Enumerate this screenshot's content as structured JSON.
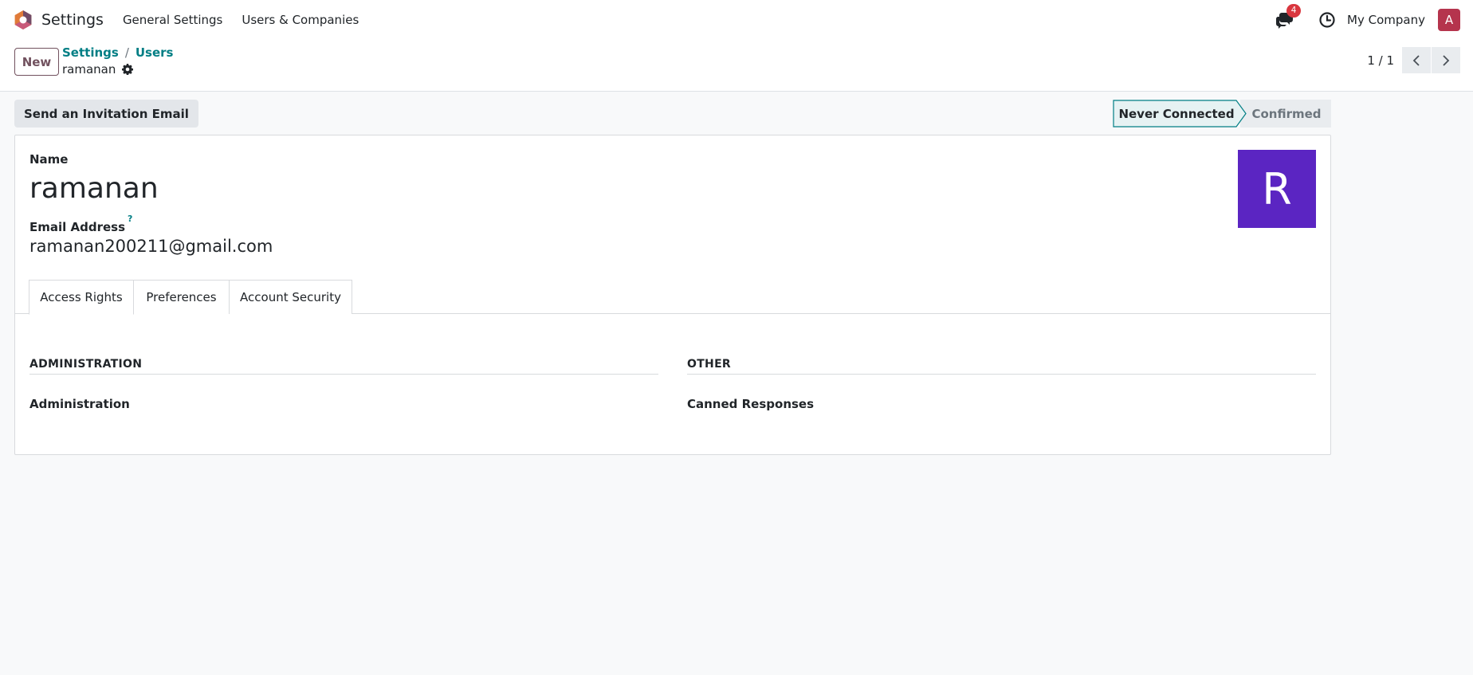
{
  "navbar": {
    "app_name": "Settings",
    "menu": [
      "General Settings",
      "Users & Companies"
    ],
    "messages_badge": "4",
    "company": "My Company",
    "user_initial": "A"
  },
  "control_panel": {
    "new_label": "New",
    "breadcrumb": [
      "Settings",
      "Users"
    ],
    "breadcrumb_sep": "/",
    "record_name": "ramanan",
    "pager": "1 / 1"
  },
  "statusbar": {
    "invite_label": "Send an Invitation Email",
    "stages": [
      "Never Connected",
      "Confirmed"
    ],
    "active_stage": "Never Connected"
  },
  "form": {
    "name_label": "Name",
    "name_value": "ramanan",
    "email_label": "Email Address",
    "email_help": "?",
    "email_value": "ramanan200211@gmail.com",
    "avatar_initial": "R",
    "tabs": [
      "Access Rights",
      "Preferences",
      "Account Security"
    ],
    "active_tab": "Access Rights",
    "sections": [
      {
        "title": "ADMINISTRATION",
        "field": "Administration"
      },
      {
        "title": "OTHER",
        "field": "Canned Responses"
      }
    ]
  },
  "colors": {
    "accent": "#017e84",
    "primary": "#71515e",
    "avatar_bg": "#5b25c2",
    "user_avatar_bg": "#b5344d",
    "badge": "#d9363e"
  }
}
